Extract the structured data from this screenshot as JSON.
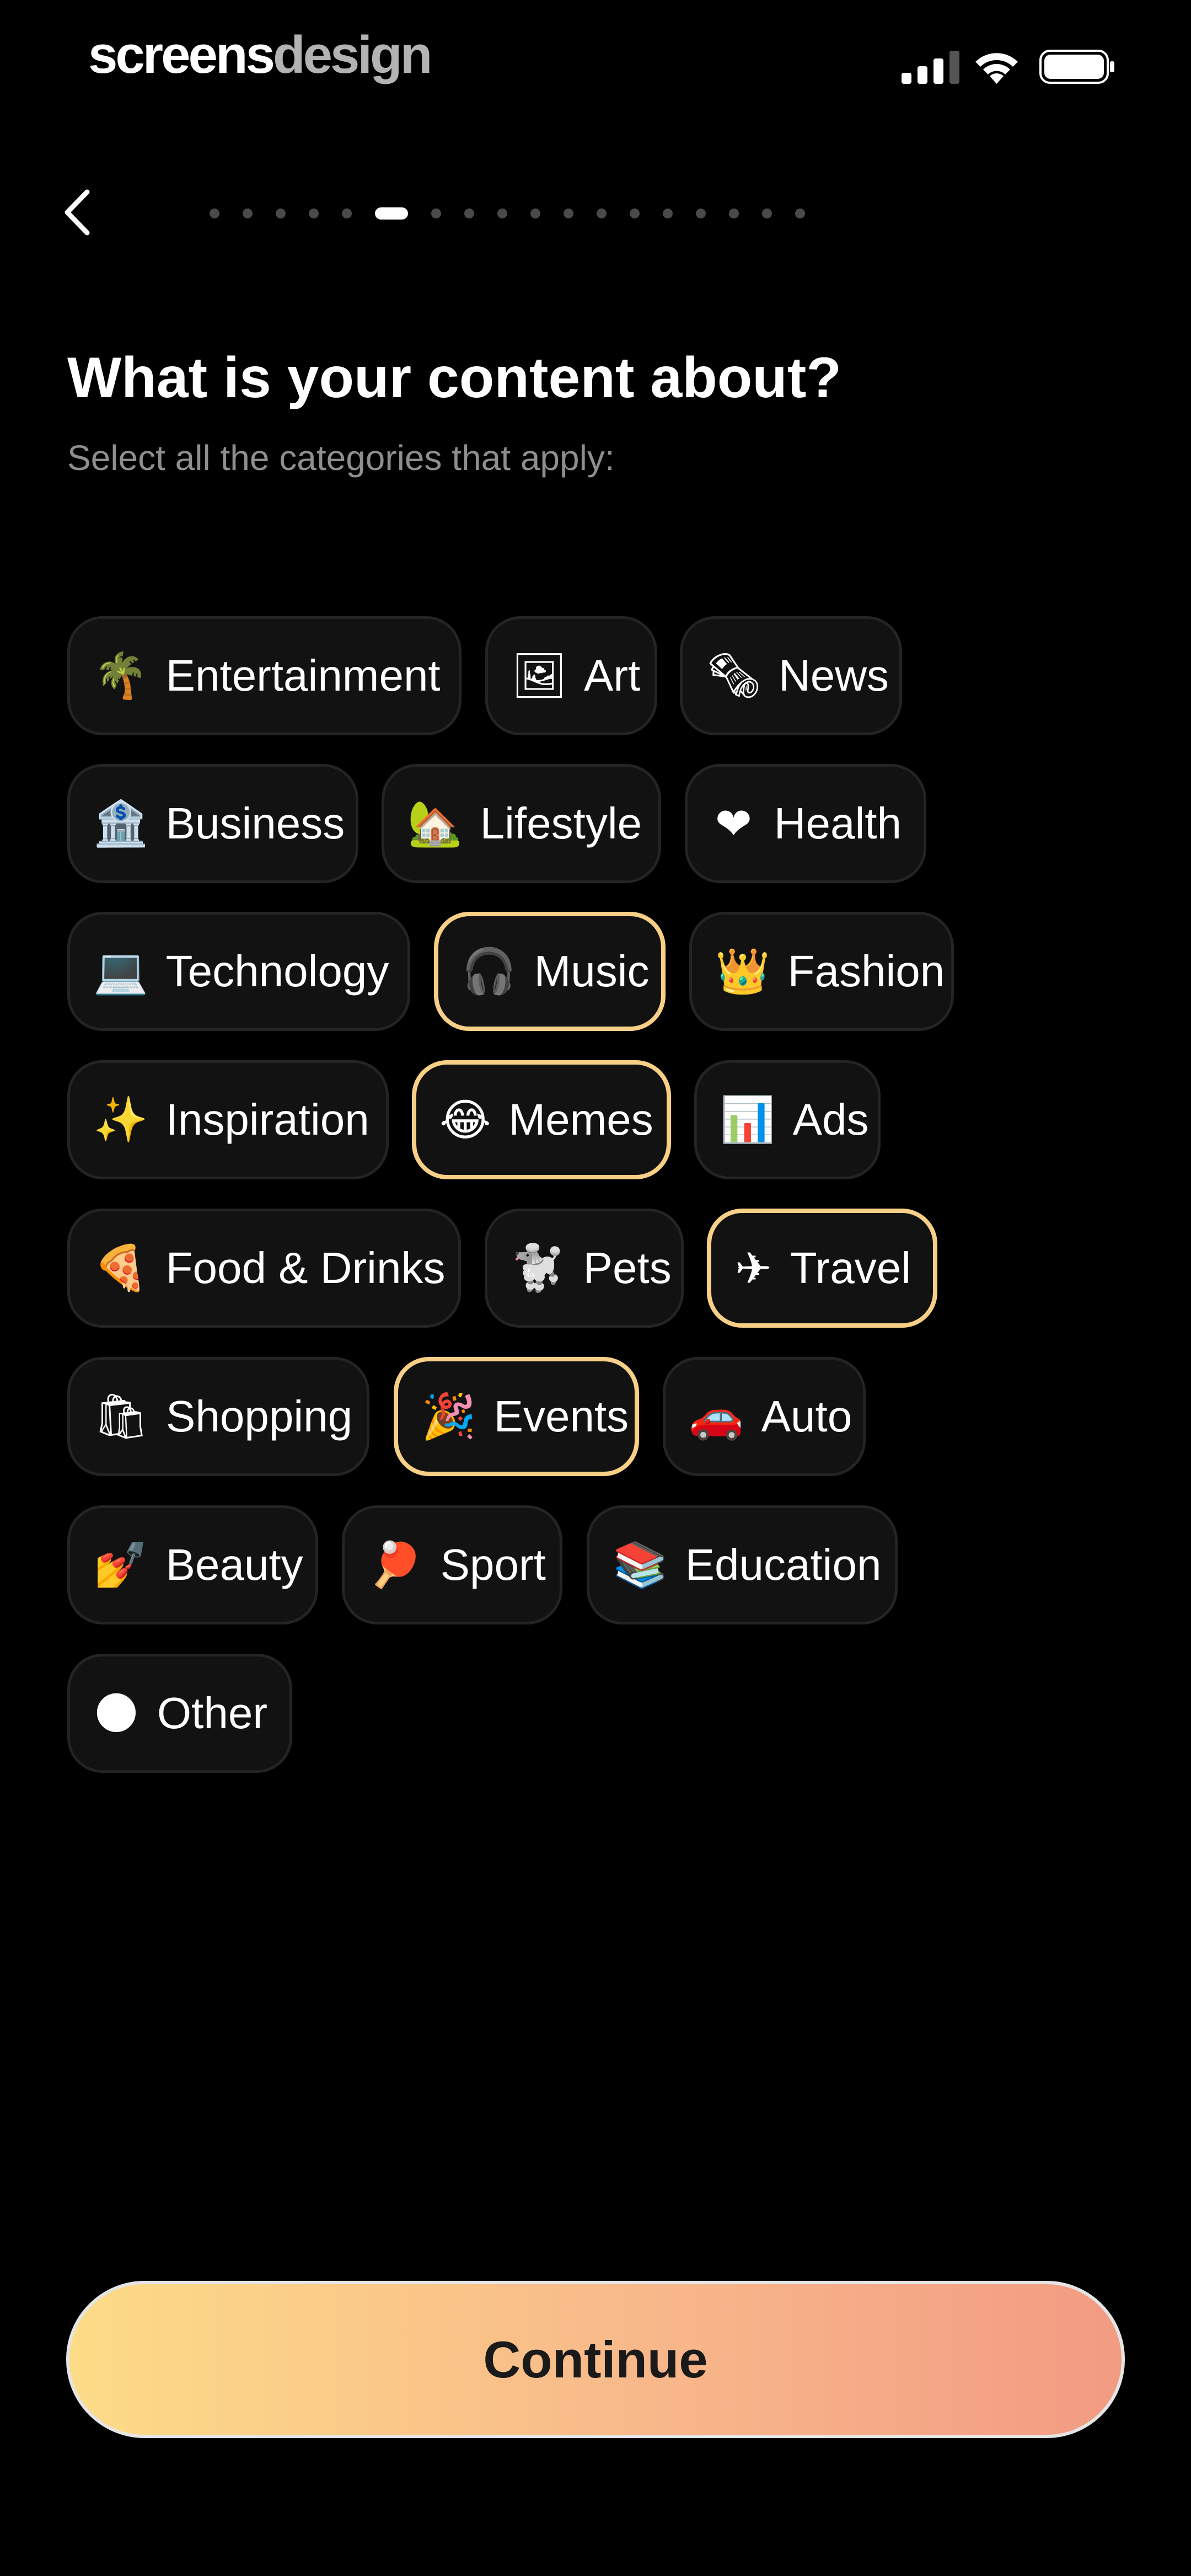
{
  "status_bar": {
    "brand_part1": "screens",
    "brand_part2": "design"
  },
  "header": {
    "title": "What is your content about?",
    "subtitle": "Select all the categories that apply:"
  },
  "progress": {
    "total_steps": 18,
    "current_step": 6
  },
  "categories": [
    {
      "emoji": "🌴",
      "label": "Entertainment",
      "selected": false
    },
    {
      "emoji": "🖼",
      "label": "Art",
      "selected": false
    },
    {
      "emoji": "🗞",
      "label": "News",
      "selected": false
    },
    {
      "emoji": "🏦",
      "label": "Business",
      "selected": false
    },
    {
      "emoji": "🏡",
      "label": "Lifestyle",
      "selected": false
    },
    {
      "emoji": "❤",
      "label": "Health",
      "selected": false
    },
    {
      "emoji": "💻",
      "label": "Technology",
      "selected": false
    },
    {
      "emoji": "🎧",
      "label": "Music",
      "selected": true
    },
    {
      "emoji": "👑",
      "label": "Fashion",
      "selected": false
    },
    {
      "emoji": "✨",
      "label": "Inspiration",
      "selected": false
    },
    {
      "emoji": "😂",
      "label": "Memes",
      "selected": true
    },
    {
      "emoji": "📊",
      "label": "Ads",
      "selected": false
    },
    {
      "emoji": "🍕",
      "label": "Food & Drinks",
      "selected": false
    },
    {
      "emoji": "🐩",
      "label": "Pets",
      "selected": false
    },
    {
      "emoji": "✈",
      "label": "Travel",
      "selected": true
    },
    {
      "emoji": "🛍",
      "label": "Shopping",
      "selected": false
    },
    {
      "emoji": "🎉",
      "label": "Events",
      "selected": true
    },
    {
      "emoji": "🚗",
      "label": "Auto",
      "selected": false
    },
    {
      "emoji": "💅",
      "label": "Beauty",
      "selected": false
    },
    {
      "emoji": "🏓",
      "label": "Sport",
      "selected": false
    },
    {
      "emoji": "📚",
      "label": "Education",
      "selected": false
    },
    {
      "emoji": "🌑",
      "label": "Other",
      "selected": false
    }
  ],
  "continue_label": "Continue",
  "colors": {
    "background": "#000000",
    "chip_bg": "#121212",
    "chip_selected_border": "#f7cf86",
    "button_gradient_start": "#fcdc87",
    "button_gradient_end": "#f29b83"
  }
}
